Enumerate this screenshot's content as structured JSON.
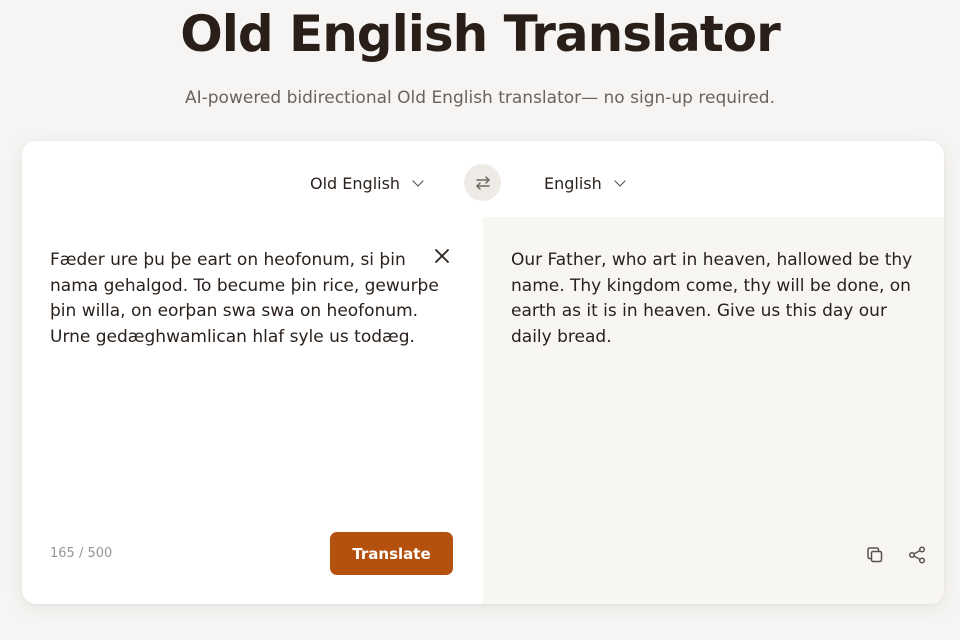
{
  "header": {
    "title": "Old English Translator",
    "subtitle": "AI-powered bidirectional Old English translator— no sign-up required."
  },
  "languages": {
    "source": "Old English",
    "target": "English"
  },
  "source": {
    "text": "Fæder ure þu þe eart on heofonum, si þin nama gehalgod. To becume þin rice, gewurþe þin willa, on eorþan swa swa on heofonum. Urne gedæghwamlican hlaf syle us todæg.",
    "char_count": "165 / 500",
    "translate_label": "Translate"
  },
  "target": {
    "text": "Our Father, who art in heaven, hallowed be thy name. Thy kingdom come, thy will be done, on earth as it is in heaven. Give us this day our daily bread."
  },
  "icons": {
    "swap": "swap-arrows-icon",
    "clear": "close-icon",
    "copy": "copy-icon",
    "share": "share-icon",
    "dropdown": "chevron-down-icon"
  },
  "colors": {
    "accent": "#b5510f",
    "background": "#f6f5f3",
    "title": "#2a1f18",
    "output_panel": "#f8f6f3"
  }
}
